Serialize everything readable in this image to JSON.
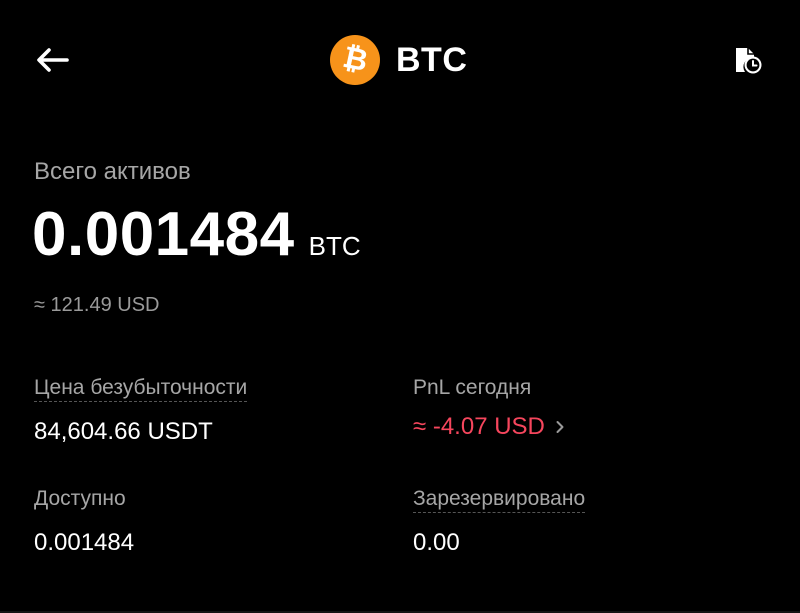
{
  "header": {
    "title": "BTC",
    "coin_symbol_glyph": "₿",
    "back_icon": "arrow-left-icon",
    "history_icon": "history-icon",
    "coin_color": "#f7931a"
  },
  "total": {
    "label": "Всего активов",
    "amount": "0.001484",
    "unit": "BTC",
    "approx": "≈ 121.49 USD"
  },
  "stats": {
    "breakeven_label": "Цена безубыточности",
    "breakeven_value": "84,604.66 USDT",
    "pnl_label": "PnL сегодня",
    "pnl_value": "≈ -4.07 USD",
    "pnl_color": "#f6465d",
    "available_label": "Доступно",
    "available_value": "0.001484",
    "reserved_label": "Зарезервировано",
    "reserved_value": "0.00"
  }
}
